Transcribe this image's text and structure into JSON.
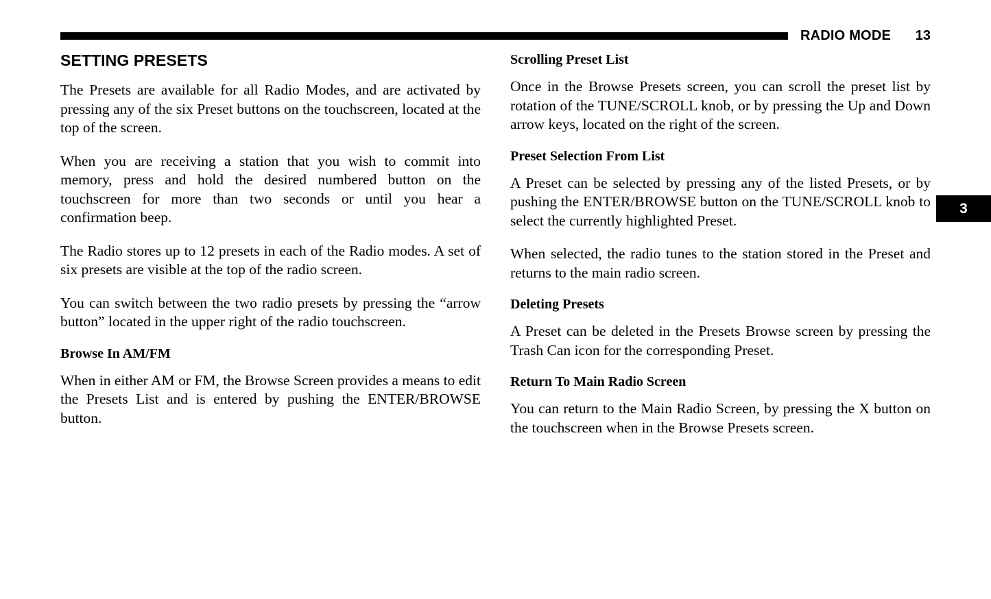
{
  "header": {
    "title": "RADIO MODE",
    "page_number": "13",
    "rule_color": "#000000"
  },
  "chapter_tab": {
    "number": "3",
    "background": "#000000",
    "text_color": "#ffffff"
  },
  "left_column": {
    "section_title": "SETTING PRESETS",
    "paragraph_1": "The Presets are available for all Radio Modes, and are activated by pressing any of the six Preset buttons on the touchscreen, located at the top of the screen.",
    "paragraph_2": "When you are receiving a station that you wish to commit into memory, press and hold the desired numbered button on the touchscreen for more than two seconds or until you hear a confirmation beep.",
    "paragraph_3": "The Radio stores up to 12 presets in each of the Radio modes. A set of six presets are visible at the top of the radio screen.",
    "paragraph_4": "You can switch between the two radio presets by pressing the “arrow button” located in the upper right of the radio touchscreen.",
    "subhead_browse": "Browse In AM/FM",
    "paragraph_5": "When in either AM or FM, the Browse Screen provides a means to edit the Presets List and is entered by pushing the ENTER/BROWSE button."
  },
  "right_column": {
    "subhead_scrolling": "Scrolling Preset List",
    "paragraph_1": "Once in the Browse Presets screen, you can scroll the preset list by rotation of the TUNE/SCROLL knob, or by pressing the Up and Down arrow keys, located on the right of the screen.",
    "subhead_selection": "Preset Selection From List",
    "paragraph_2": "A Preset can be selected by pressing any of the listed Presets, or by pushing the ENTER/BROWSE button on the TUNE/SCROLL knob to select the currently highlighted Preset.",
    "paragraph_3": "When selected, the radio tunes to the station stored in the Preset and returns to the main radio screen.",
    "subhead_deleting": "Deleting Presets",
    "paragraph_4": "A Preset can be deleted in the Presets Browse screen by pressing the Trash Can icon for the corresponding Preset.",
    "subhead_return": "Return To Main Radio Screen",
    "paragraph_5": "You can return to the Main Radio Screen, by pressing the X button on the touchscreen when in the Browse Presets screen."
  }
}
